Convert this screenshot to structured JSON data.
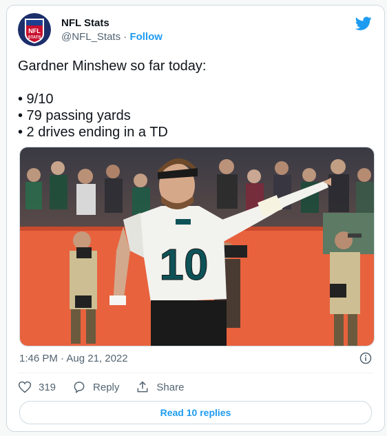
{
  "account": {
    "name": "NFL Stats",
    "handle": "@NFL_Stats",
    "separator": "·",
    "follow_label": "Follow",
    "avatar_text_top": "NFL",
    "avatar_text_bottom": "STATS"
  },
  "tweet": {
    "text": "Gardner Minshew so far today:\n\n• 9/10\n• 79 passing yards\n• 2 drives ending in a TD",
    "jersey_number": "10",
    "timestamp": "1:46 PM · Aug 21, 2022"
  },
  "actions": {
    "like_count": "319",
    "reply_label": "Reply",
    "share_label": "Share",
    "read_replies_label": "Read 10 replies"
  },
  "colors": {
    "accent": "#1d9bf0",
    "muted_text": "#536471",
    "jersey": "#f2f2ee",
    "jersey_number": "#0d5257",
    "wall": "#e8623e"
  },
  "icons": [
    "twitter-bird-icon",
    "info-icon",
    "heart-icon",
    "reply-bubble-icon",
    "share-icon"
  ]
}
